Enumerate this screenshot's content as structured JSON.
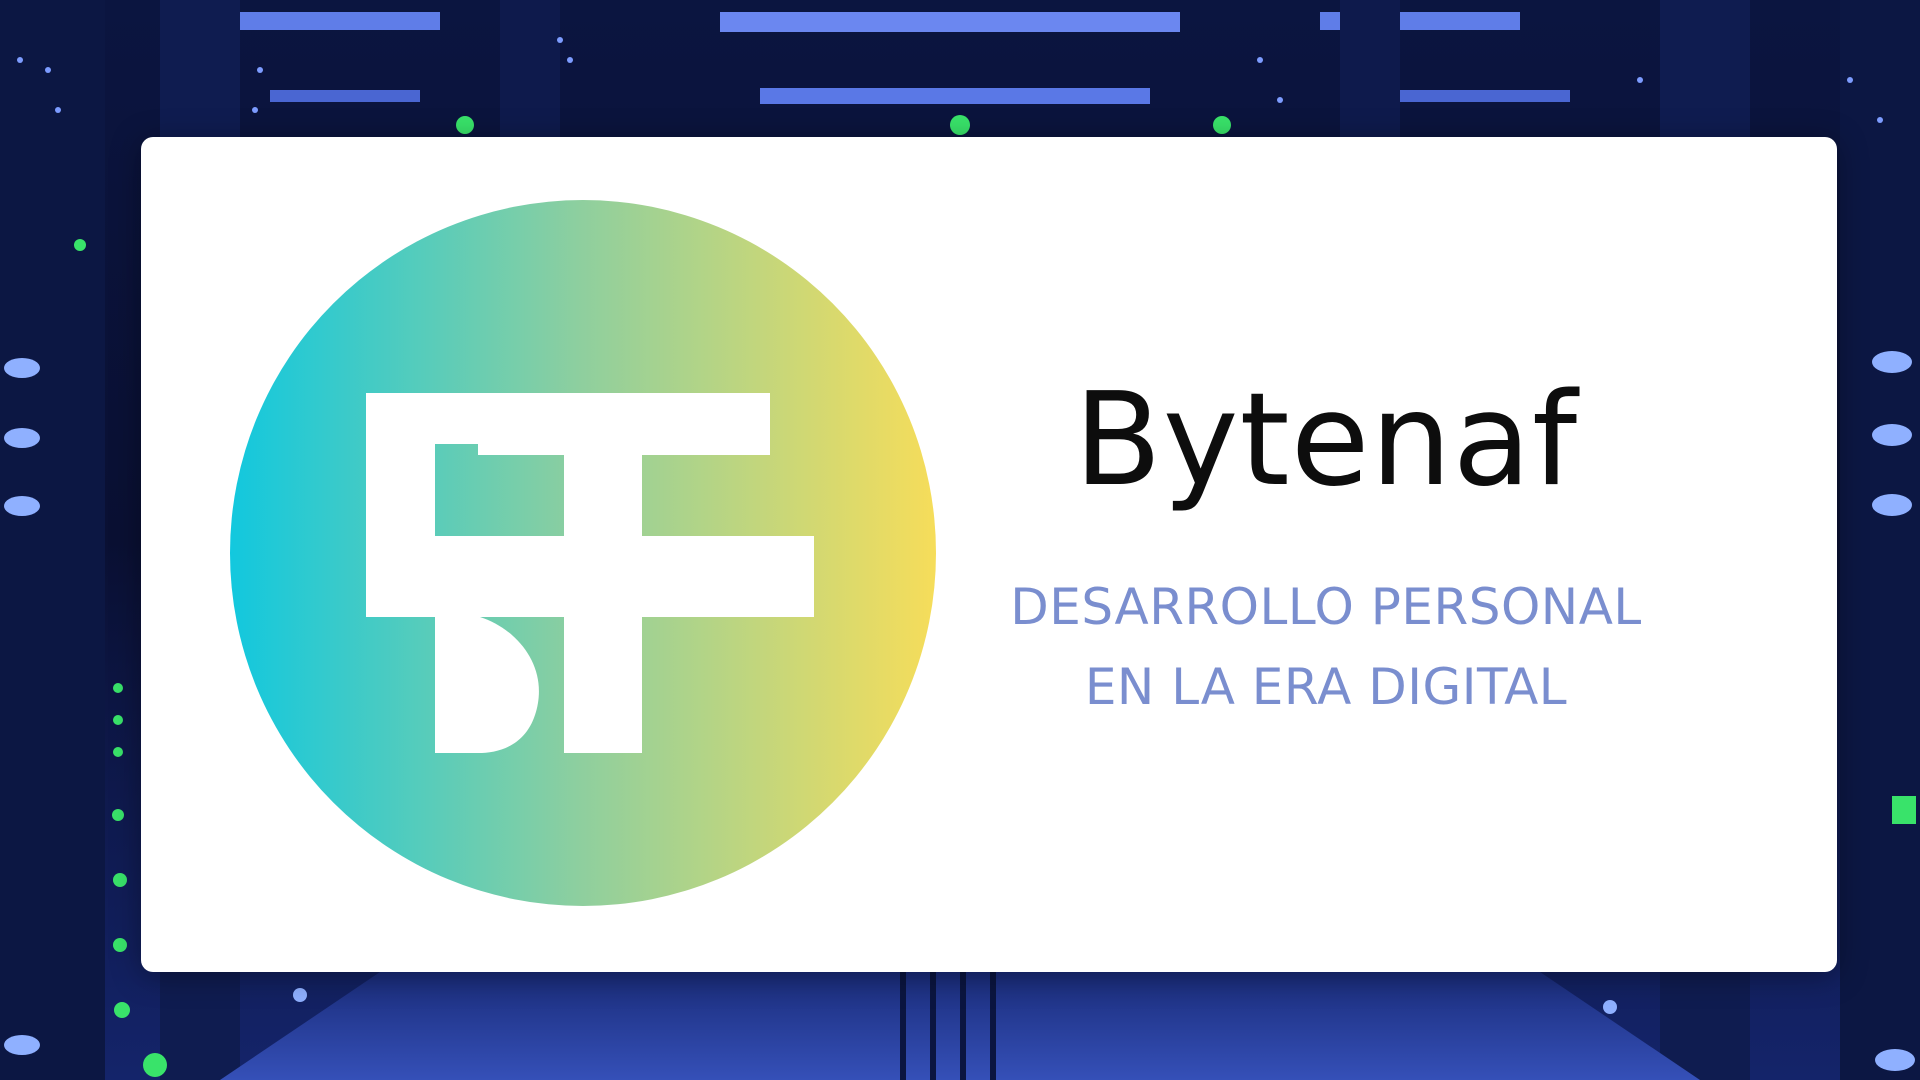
{
  "brand": {
    "name": "Bytenaf",
    "logo_monogram": "BF",
    "tagline_line1": "DESARROLLO PERSONAL",
    "tagline_line2": "EN LA ERA DIGITAL"
  },
  "colors": {
    "tagline": "#7a8ecf",
    "title": "#0d0d0d",
    "logo_gradient_start": "#12c8de",
    "logo_gradient_end": "#f6dd5a",
    "background": "#0a1236"
  },
  "background_image": "server-room-photo"
}
